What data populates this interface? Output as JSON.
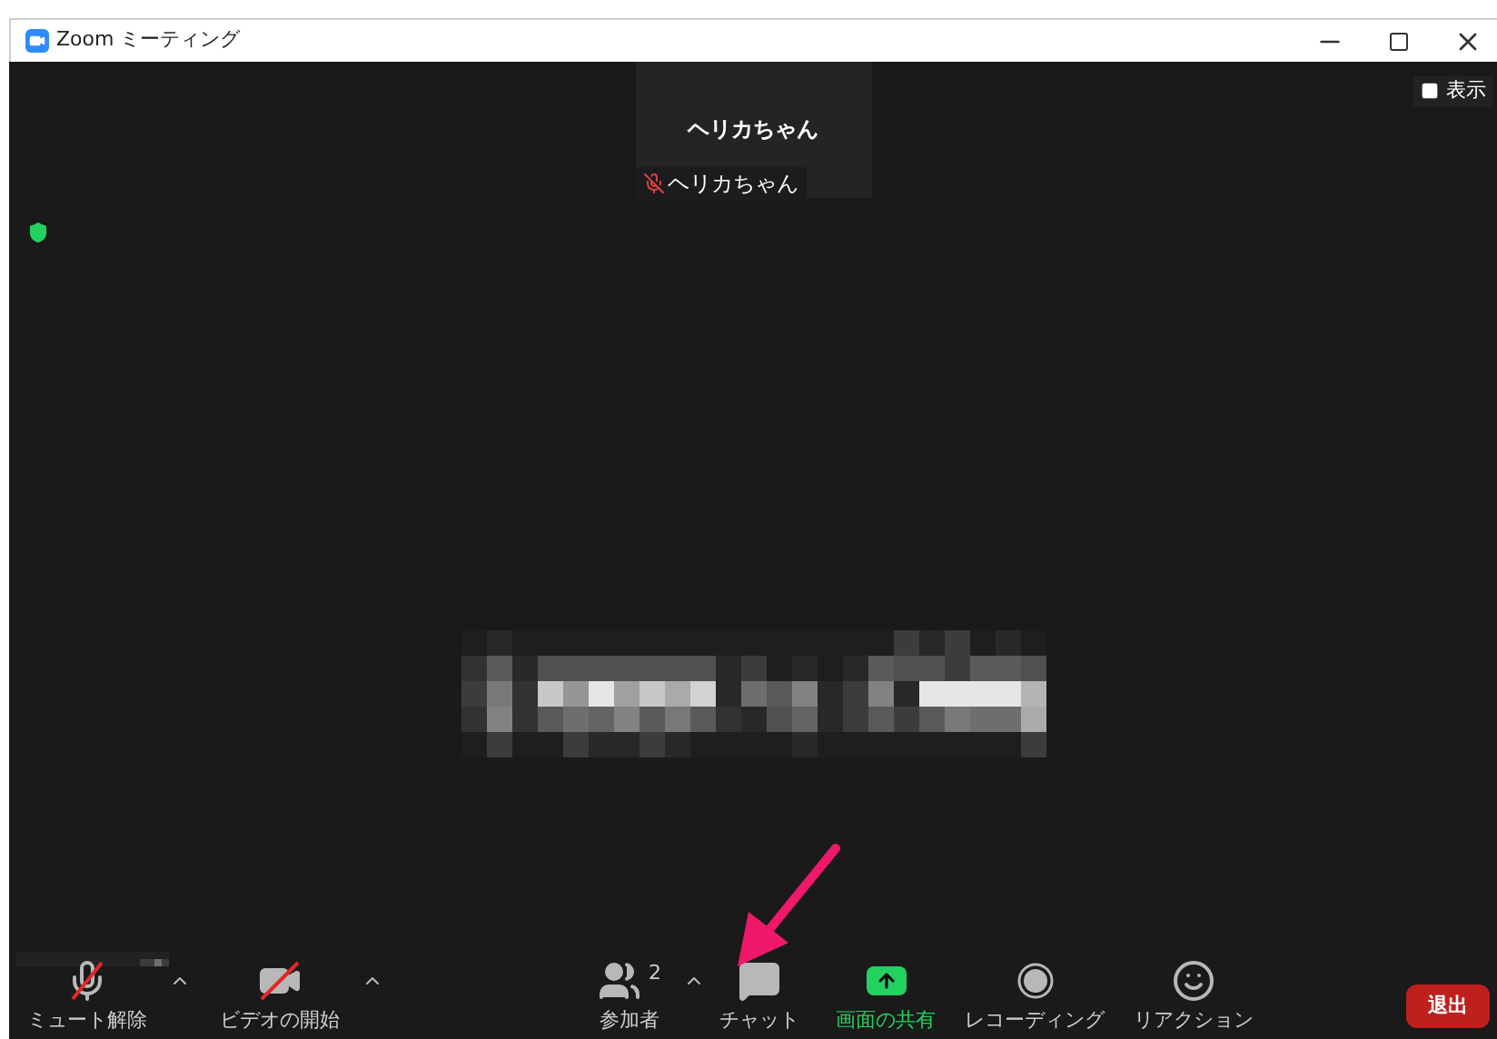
{
  "window": {
    "title": "Zoom ミーティング"
  },
  "participant_tile": {
    "name": "ヘリカちゃん",
    "label": "ヘリカちゃん",
    "muted": true
  },
  "view_button": {
    "label": "表示"
  },
  "toolbar": [
    {
      "kind": "mic",
      "label": "ミュート解除",
      "off": true,
      "caret": true
    },
    {
      "kind": "video",
      "label": "ビデオの開始",
      "off": true,
      "caret": true
    },
    {
      "kind": "participants",
      "label": "参加者",
      "count": "2",
      "caret": true
    },
    {
      "kind": "chat",
      "label": "チャット"
    },
    {
      "kind": "share",
      "label": "画面の共有"
    },
    {
      "kind": "record",
      "label": "レコーディング"
    },
    {
      "kind": "reaction",
      "label": "リアクション"
    }
  ],
  "leave_button": {
    "label": "退出"
  }
}
